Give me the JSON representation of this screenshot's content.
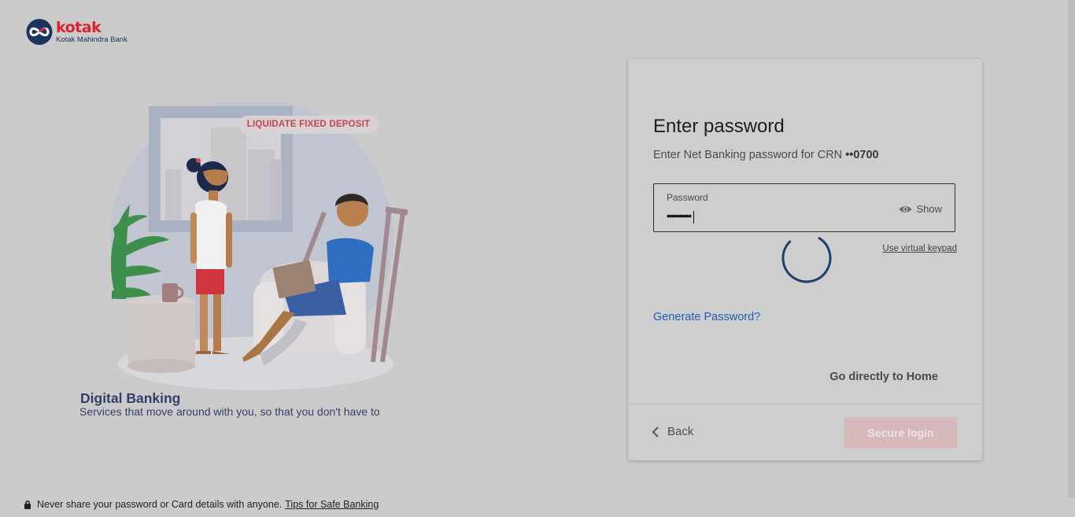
{
  "brand": {
    "name": "kotak",
    "subtitle": "Kotak Mahindra Bank",
    "colors": {
      "red": "#e0202e",
      "navy": "#1c3460"
    }
  },
  "promo": {
    "tag": "LIQUIDATE FIXED DEPOSIT",
    "title": "Digital Banking",
    "subtitle": "Services that move around with you, so that you don't have to"
  },
  "login_card": {
    "title": "Enter password",
    "subtitle_prefix": "Enter Net Banking password for CRN ",
    "crn_masked": "••0700",
    "password_label": "Password",
    "password_value": "••••••••••",
    "show_label": "Show",
    "virtual_keypad_label": "Use virtual keypad",
    "generate_password_label": "Generate Password?",
    "go_home_label": "Go directly to Home",
    "back_label": "Back",
    "secure_login_label": "Secure login",
    "icons": [
      "eye-icon",
      "chevron-left-icon",
      "loading-spinner"
    ]
  },
  "footer": {
    "note": "Never share your password or Card details with anyone.",
    "link": "Tips for Safe Banking",
    "icon": "lock-icon"
  }
}
